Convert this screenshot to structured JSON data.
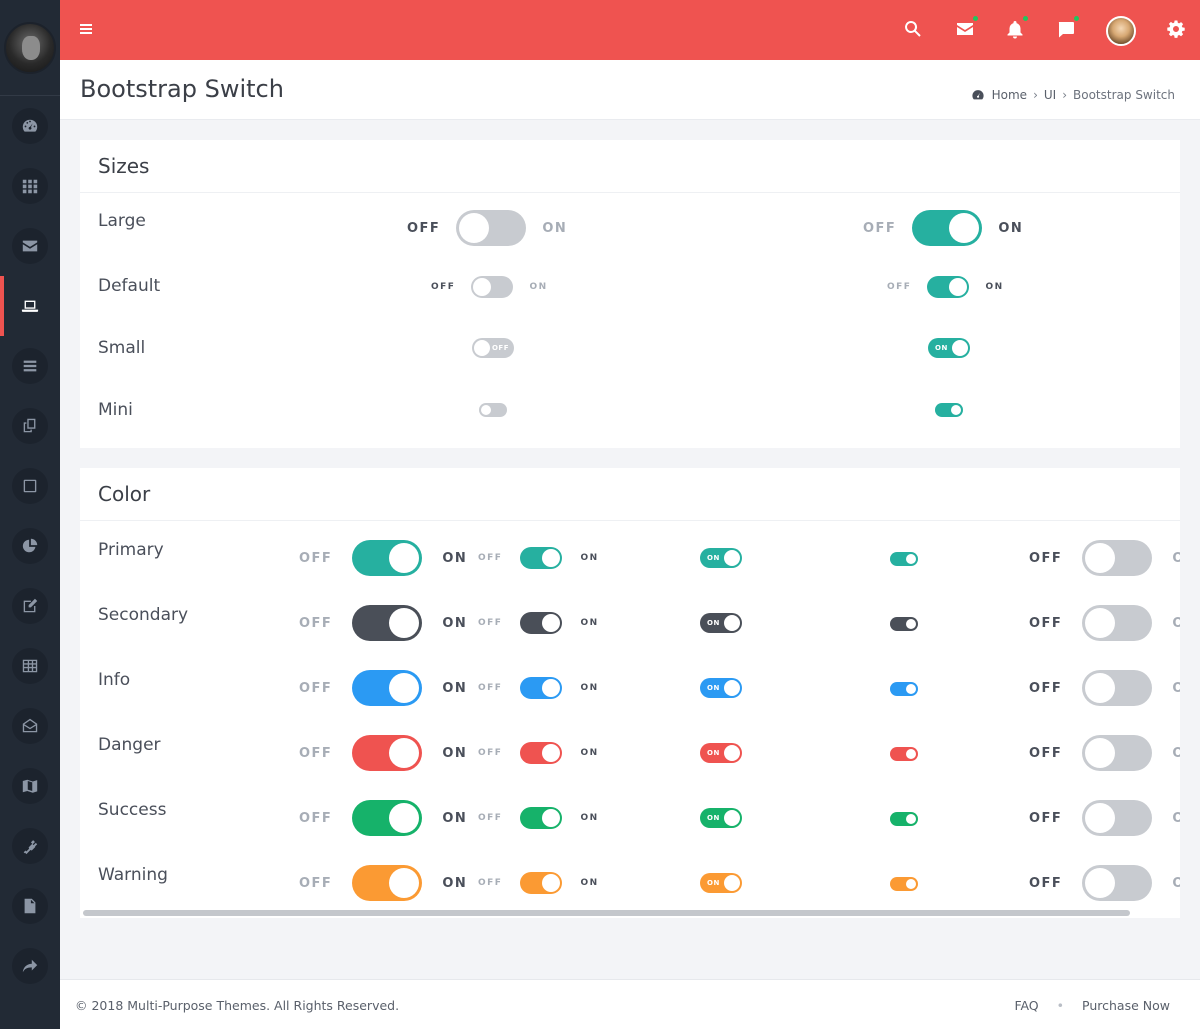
{
  "header": {
    "title": "Bootstrap Switch",
    "breadcrumb": {
      "home": "Home",
      "section": "UI",
      "current": "Bootstrap Switch"
    }
  },
  "topbar": {
    "icons": [
      "menu-icon",
      "search-icon",
      "mail-icon",
      "bell-icon",
      "chat-icon",
      "user-avatar",
      "gear-icon"
    ],
    "notification_dot_color": "#22c55e",
    "brand_color": "#ef5350"
  },
  "sidebar": {
    "items": [
      "dashboard-icon",
      "apps-icon",
      "mail-icon",
      "laptop-icon",
      "list-icon",
      "copy-icon",
      "square-icon",
      "pie-chart-icon",
      "edit-icon",
      "table-icon",
      "envelope-open-icon",
      "map-icon",
      "plug-icon",
      "file-icon",
      "share-icon"
    ],
    "active_index": 3
  },
  "sizes": {
    "title": "Sizes",
    "rows": {
      "large": "Large",
      "default": "Default",
      "small": "Small",
      "mini": "Mini"
    },
    "off": "OFF",
    "on": "ON",
    "states": [
      false,
      true
    ]
  },
  "color": {
    "title": "Color",
    "rows": {
      "primary": "Primary",
      "secondary": "Secondary",
      "info": "Info",
      "danger": "Danger",
      "success": "Success",
      "warning": "Warning"
    },
    "colors": {
      "primary": "#26b0a0",
      "secondary": "#4a4f58",
      "info": "#2b9af3",
      "danger": "#ef5350",
      "success": "#16b26a",
      "warning": "#fb9a33",
      "off_track": "#c8cbd0"
    },
    "off": "OFF",
    "on": "ON"
  },
  "footer": {
    "copyright": "© 2018 Multi-Purpose Themes. All Rights Reserved.",
    "faq": "FAQ",
    "purchase": "Purchase Now"
  }
}
